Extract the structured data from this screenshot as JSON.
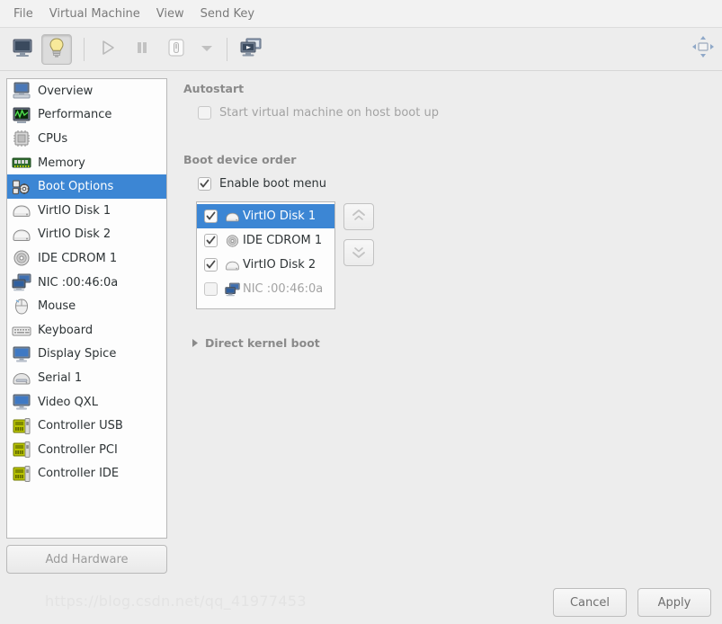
{
  "menubar": {
    "items": [
      {
        "label": "File",
        "name": "menu-file"
      },
      {
        "label": "Virtual Machine",
        "name": "menu-virtual-machine"
      },
      {
        "label": "View",
        "name": "menu-view"
      },
      {
        "label": "Send Key",
        "name": "menu-send-key"
      }
    ]
  },
  "toolbar": {
    "buttons": [
      {
        "icon": "console-monitor-icon",
        "pressed": false
      },
      {
        "icon": "show-details-lightbulb-icon",
        "pressed": true
      },
      {
        "icon": "run-play-icon",
        "pressed": false
      },
      {
        "icon": "pause-icon",
        "pressed": false
      },
      {
        "icon": "shutdown-icon",
        "pressed": false
      }
    ],
    "dropdown_icon": "chevron-down-icon",
    "snapshot_icon": "snapshots-icon",
    "fullscreen_icon": "fullscreen-expand-icon"
  },
  "sidebar": {
    "items": [
      {
        "label": "Overview",
        "icon": "computer-icon",
        "selected": false
      },
      {
        "label": "Performance",
        "icon": "performance-graph-icon",
        "selected": false
      },
      {
        "label": "CPUs",
        "icon": "cpu-chip-icon",
        "selected": false
      },
      {
        "label": "Memory",
        "icon": "memory-ram-icon",
        "selected": false
      },
      {
        "label": "Boot Options",
        "icon": "boot-options-icon",
        "selected": true
      },
      {
        "label": "VirtIO Disk 1",
        "icon": "harddisk-icon",
        "selected": false
      },
      {
        "label": "VirtIO Disk 2",
        "icon": "harddisk-icon",
        "selected": false
      },
      {
        "label": "IDE CDROM 1",
        "icon": "cdrom-icon",
        "selected": false
      },
      {
        "label": "NIC :00:46:0a",
        "icon": "network-icon",
        "selected": false
      },
      {
        "label": "Mouse",
        "icon": "mouse-icon",
        "selected": false
      },
      {
        "label": "Keyboard",
        "icon": "keyboard-icon",
        "selected": false
      },
      {
        "label": "Display Spice",
        "icon": "display-icon",
        "selected": false
      },
      {
        "label": "Serial 1",
        "icon": "serial-port-icon",
        "selected": false
      },
      {
        "label": "Video QXL",
        "icon": "display-icon",
        "selected": false
      },
      {
        "label": "Controller USB",
        "icon": "controller-card-icon",
        "selected": false
      },
      {
        "label": "Controller PCI",
        "icon": "controller-card-icon",
        "selected": false
      },
      {
        "label": "Controller IDE",
        "icon": "controller-card-icon",
        "selected": false
      }
    ],
    "add_hardware_label": "Add Hardware"
  },
  "main": {
    "autostart": {
      "title": "Autostart",
      "checkbox_label": "Start virtual machine on host boot up",
      "checked": false,
      "disabled": true
    },
    "boot_order": {
      "title": "Boot device order",
      "enable_boot_menu_label": "Enable boot menu",
      "enable_boot_menu_checked": true,
      "devices": [
        {
          "label": "VirtIO Disk 1",
          "icon": "harddisk-icon",
          "checked": true,
          "selected": true,
          "enabled": true
        },
        {
          "label": "IDE CDROM 1",
          "icon": "cdrom-icon",
          "checked": true,
          "selected": false,
          "enabled": true
        },
        {
          "label": "VirtIO Disk 2",
          "icon": "harddisk-icon",
          "checked": true,
          "selected": false,
          "enabled": true
        },
        {
          "label": "NIC :00:46:0a",
          "icon": "network-icon",
          "checked": false,
          "selected": false,
          "enabled": false
        }
      ],
      "move_up_icon": "move-up-icon",
      "move_down_icon": "move-down-icon"
    },
    "direct_kernel_boot": {
      "label": "Direct kernel boot",
      "expanded": false
    }
  },
  "footer": {
    "cancel_label": "Cancel",
    "apply_label": "Apply",
    "watermark": "https://blog.csdn.net/qq_41977453"
  },
  "colors": {
    "selection_blue": "#3c86d4",
    "window_bg": "#ededed",
    "list_bg": "#fdfdfd"
  }
}
